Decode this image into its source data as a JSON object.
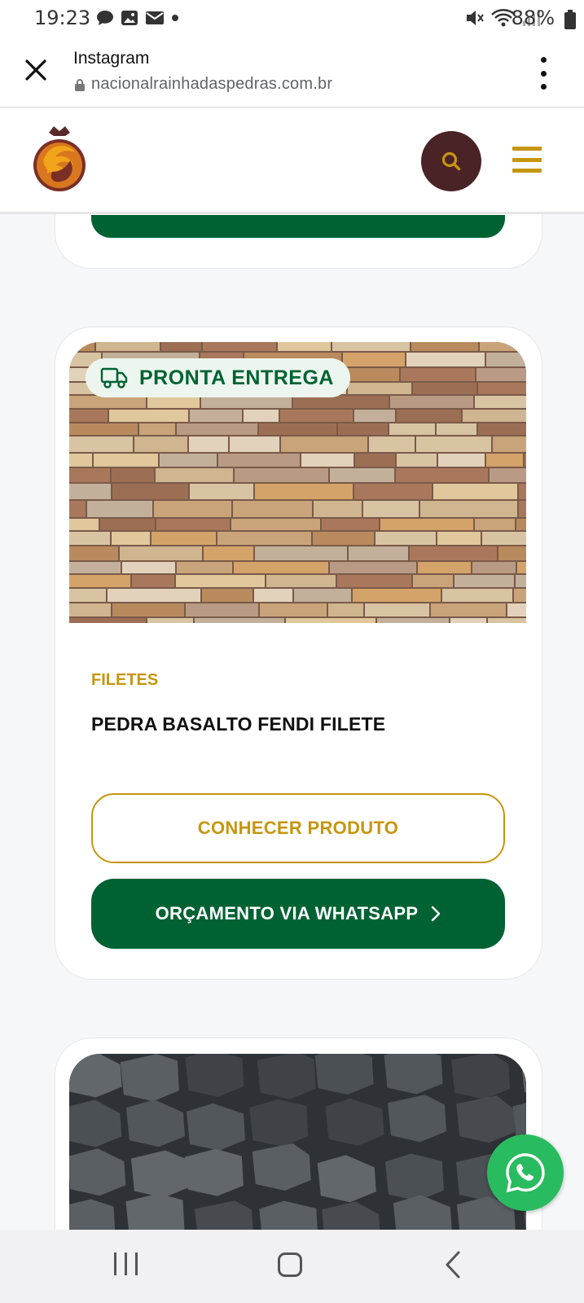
{
  "status_bar": {
    "time": "19:23",
    "battery": "88%",
    "left_icons": [
      "chat-bubble-icon",
      "image-icon",
      "mail-icon",
      "dot-icon"
    ],
    "right_icons": [
      "mute-icon",
      "wifi-icon",
      "signal-icon",
      "battery-icon"
    ]
  },
  "browser": {
    "title": "Instagram",
    "url": "nacionalrainhadaspedras.com.br",
    "close_icon": "close-icon",
    "menu_icon": "kebab-menu-icon"
  },
  "header": {
    "logo": "rainha-das-pedras-logo",
    "search_icon": "search-icon",
    "menu_icon": "hamburger-icon",
    "colors": {
      "search_bg": "#4a2327",
      "accent": "#c6960e"
    }
  },
  "product": {
    "badge": "PRONTA ENTREGA",
    "badge_icon": "delivery-truck-icon",
    "category": "FILETES",
    "name": "PEDRA BASALTO FENDI FILETE",
    "primary_button": "CONHECER PRODUTO",
    "secondary_button": "ORÇAMENTO VIA WHATSAPP",
    "secondary_icon": "chevron-right-icon",
    "colors": {
      "green": "#006233",
      "gold": "#c6960e"
    }
  },
  "fab": {
    "icon": "whatsapp-icon",
    "color": "#29bb5f"
  },
  "nav": {
    "icons": [
      "recent-apps-icon",
      "home-icon",
      "back-icon"
    ]
  }
}
